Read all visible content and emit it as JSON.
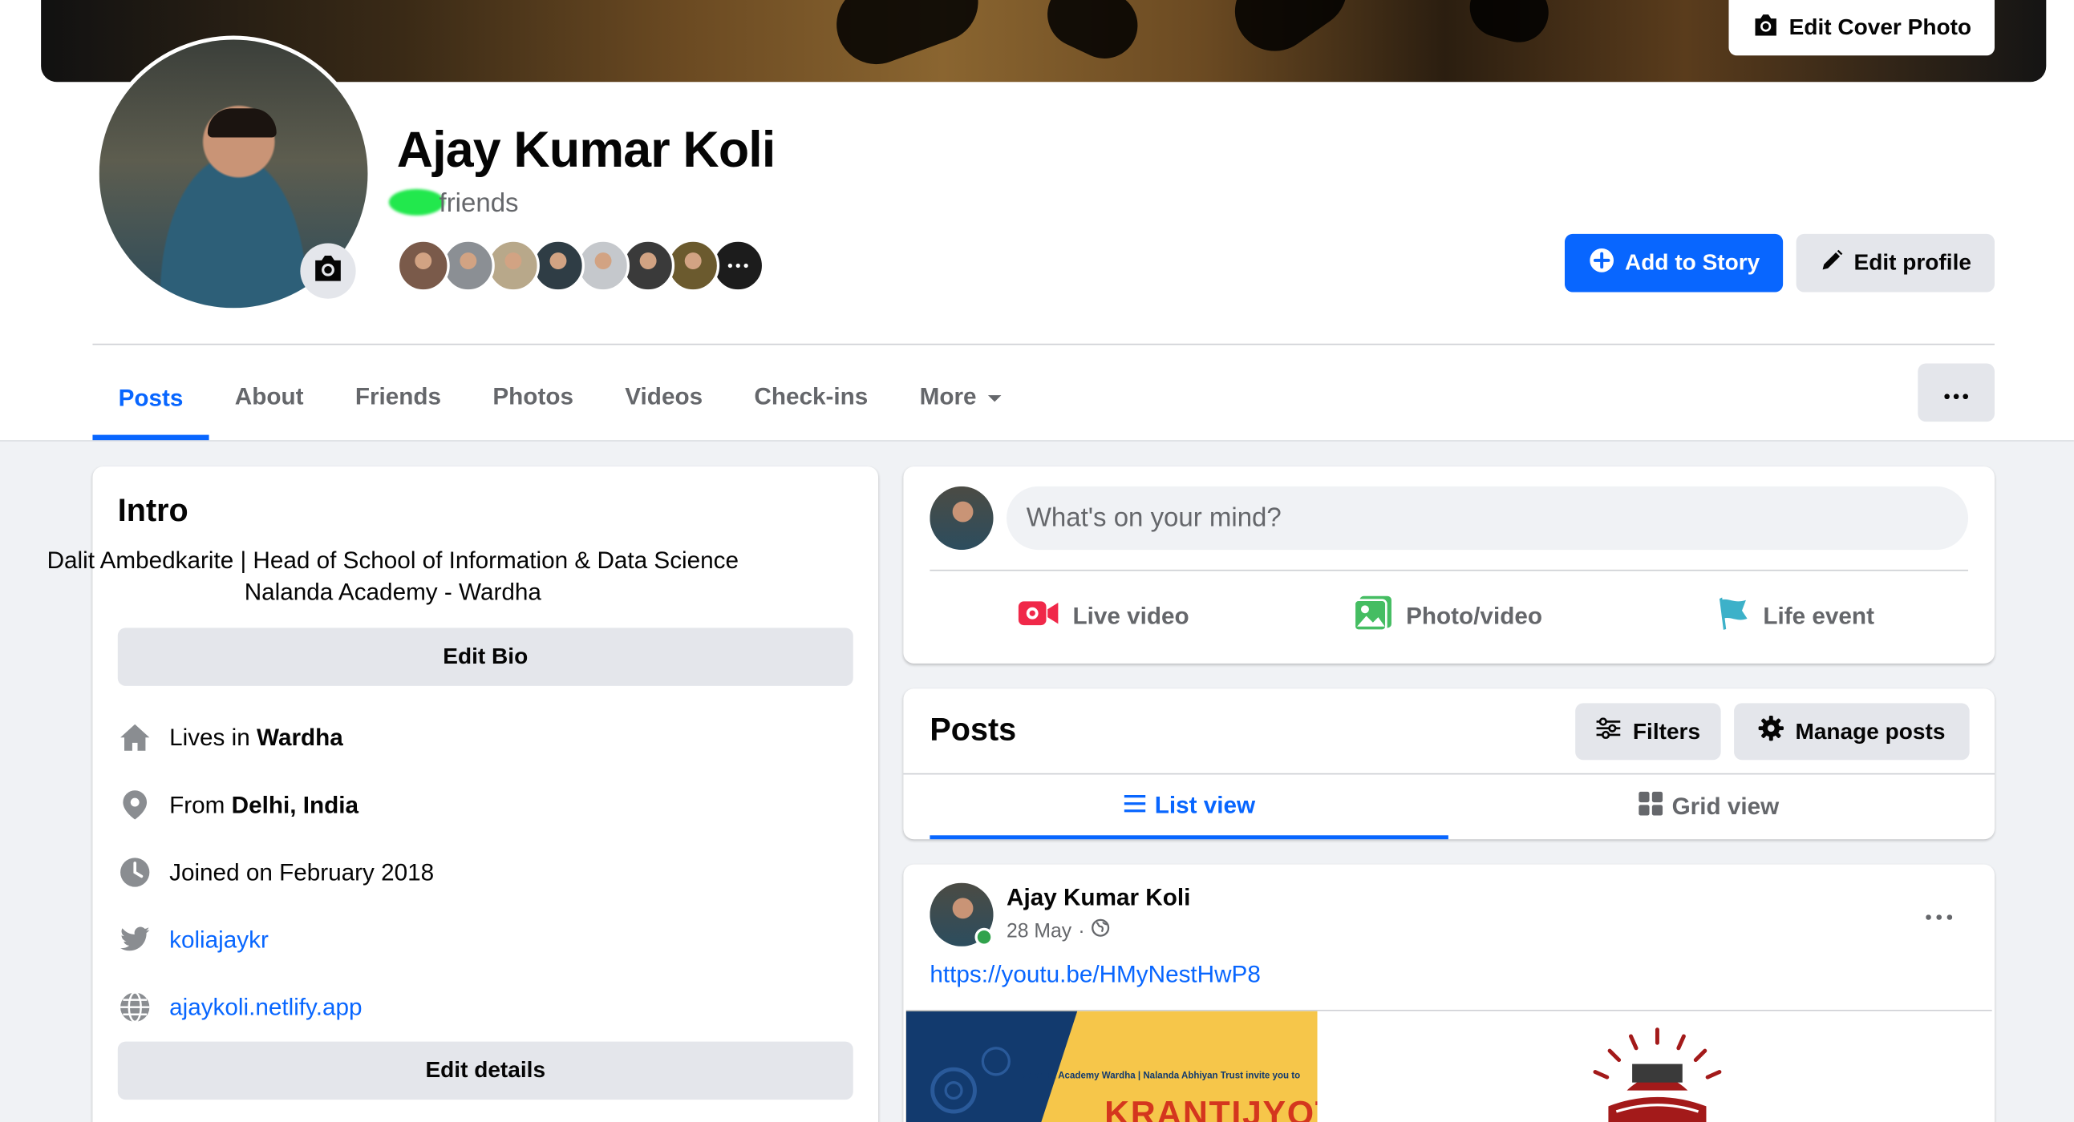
{
  "profile": {
    "name": "Ajay Kumar Koli",
    "friends_label": "friends",
    "edit_cover_label": "Edit Cover Photo",
    "add_to_story_label": "Add to Story",
    "edit_profile_label": "Edit profile"
  },
  "friend_faces": [
    {
      "icon": "friend-avatar-1",
      "color": "#7a5a4a"
    },
    {
      "icon": "friend-avatar-2",
      "color": "#8b8f94"
    },
    {
      "icon": "friend-avatar-3",
      "color": "#b8a88a"
    },
    {
      "icon": "friend-avatar-4",
      "color": "#2f3d45"
    },
    {
      "icon": "friend-avatar-5",
      "color": "#c5c8cc"
    },
    {
      "icon": "friend-avatar-6",
      "color": "#3a3a3a"
    },
    {
      "icon": "friend-avatar-7",
      "color": "#6b5a2e"
    },
    {
      "icon": "more-friends-icon",
      "color": "#1c1c1c"
    }
  ],
  "tabs": [
    {
      "label": "Posts",
      "active": true
    },
    {
      "label": "About",
      "active": false
    },
    {
      "label": "Friends",
      "active": false
    },
    {
      "label": "Photos",
      "active": false
    },
    {
      "label": "Videos",
      "active": false
    },
    {
      "label": "Check-ins",
      "active": false
    },
    {
      "label": "More",
      "active": false
    }
  ],
  "intro": {
    "title": "Intro",
    "bio_line1": "Dalit Ambedkarite | Head of School of Information & Data Science",
    "bio_line2": "Nalanda Academy - Wardha",
    "edit_bio_label": "Edit Bio",
    "lives_prefix": "Lives in",
    "lives_value": "Wardha",
    "from_prefix": "From",
    "from_value": "Delhi, India",
    "joined": "Joined on February 2018",
    "twitter": "koliajaykr",
    "website": "ajaykoli.netlify.app",
    "edit_details_label": "Edit details"
  },
  "composer": {
    "placeholder": "What's on your mind?",
    "live_video": "Live video",
    "photo_video": "Photo/video",
    "life_event": "Life event"
  },
  "posts_section": {
    "title": "Posts",
    "filters_label": "Filters",
    "manage_label": "Manage posts",
    "list_view_label": "List view",
    "grid_view_label": "Grid view"
  },
  "post": {
    "author": "Ajay Kumar Koli",
    "date": "28 May",
    "separator": "·",
    "link": "https://youtu.be/HMyNestHwP8",
    "poster_small_text": "Nalanda Academy Wardha | Nalanda Abhiyan Trust invite you to",
    "poster_title": "KRANTIJYOTI"
  },
  "colors": {
    "accent": "#0866ff",
    "online": "#31a24c",
    "background": "#f0f2f5"
  }
}
